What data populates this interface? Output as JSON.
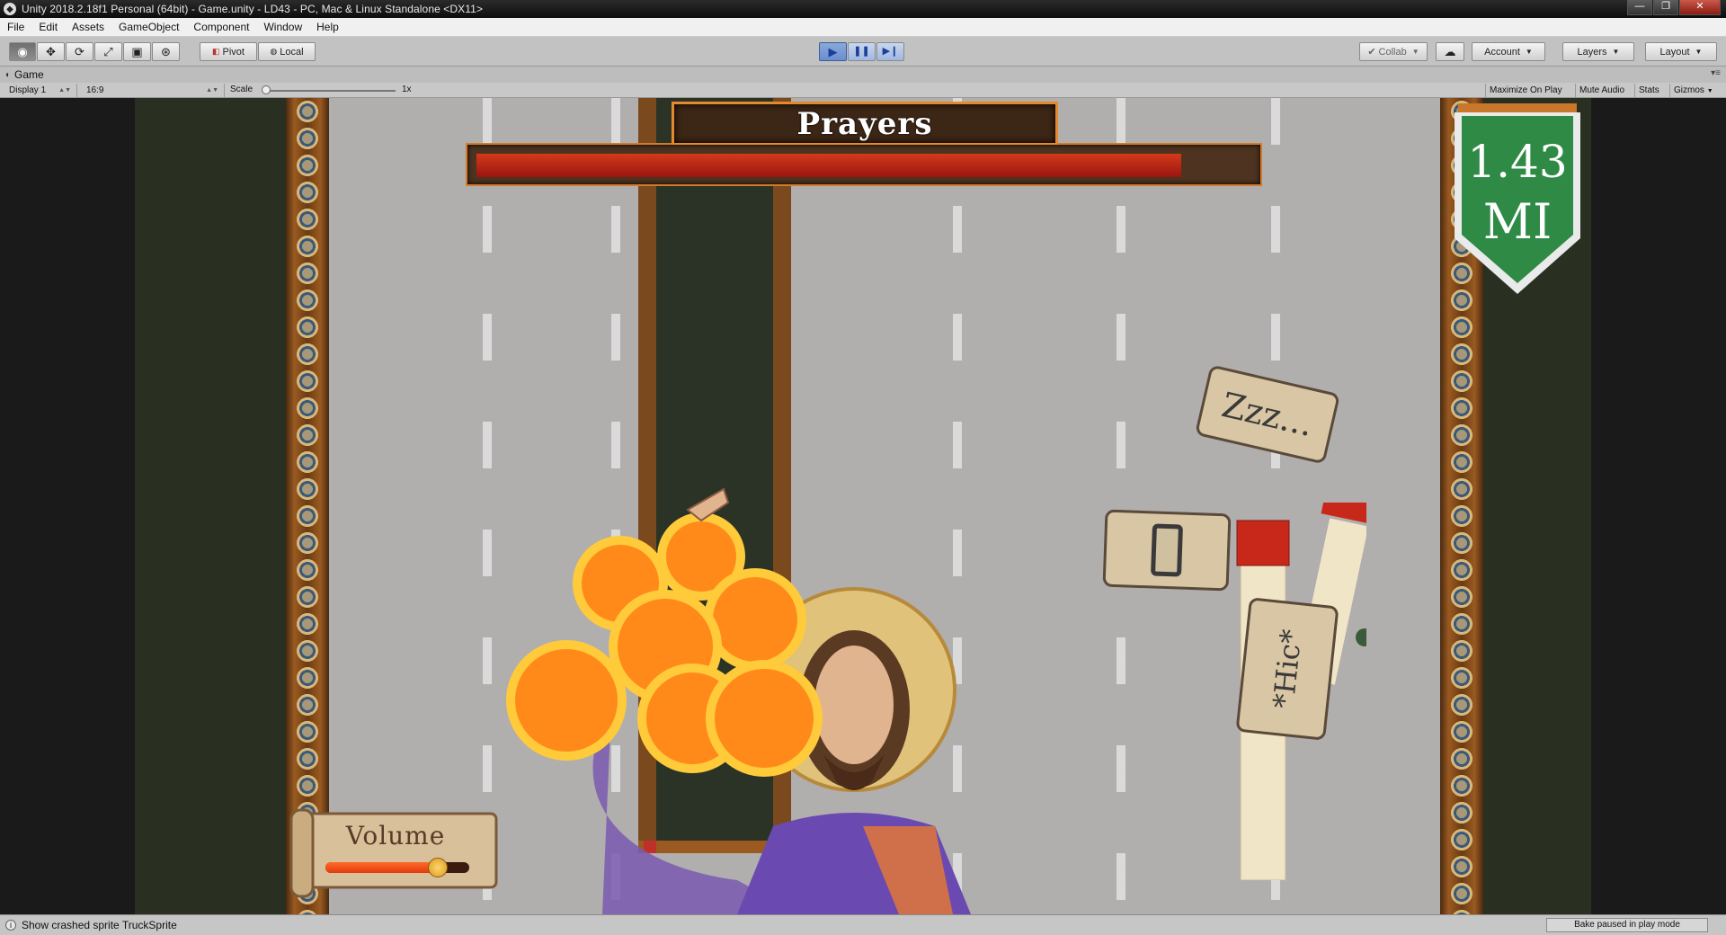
{
  "window": {
    "title": "Unity 2018.2.18f1 Personal (64bit) - Game.unity - LD43 - PC, Mac & Linux Standalone <DX11>"
  },
  "menubar": {
    "items": [
      "File",
      "Edit",
      "Assets",
      "GameObject",
      "Component",
      "Window",
      "Help"
    ]
  },
  "toolbar": {
    "pivot_label": "Pivot",
    "local_label": "Local",
    "collab_label": "Collab",
    "account_label": "Account",
    "layers_label": "Layers",
    "layout_label": "Layout",
    "play_glyph": "▶",
    "pause_glyph": "❚❚",
    "step_glyph": "▶❙"
  },
  "game_tab": {
    "label": "Game"
  },
  "game_bar": {
    "display": "Display 1",
    "aspect": "16:9",
    "scale_label": "Scale",
    "scale_value": "1x",
    "maximize_label": "Maximize On Play",
    "mute_label": "Mute Audio",
    "stats_label": "Stats",
    "gizmos_label": "Gizmos"
  },
  "game": {
    "prayers_title": "Prayers",
    "prayers_level": 0.91,
    "distance_value": "1.43",
    "distance_unit": "MI",
    "volume_label": "Volume",
    "volume_level": 0.78,
    "bubble_zzz": "Zzz...",
    "bubble_hic": "*Hic*"
  },
  "colors": {
    "pennant_green": "#2e8a45",
    "prayers_fill": "#c8281a",
    "road": "#b1aeae"
  },
  "statusbar": {
    "message": "Show crashed sprite TruckSprite",
    "bake": "Bake paused in play mode"
  }
}
